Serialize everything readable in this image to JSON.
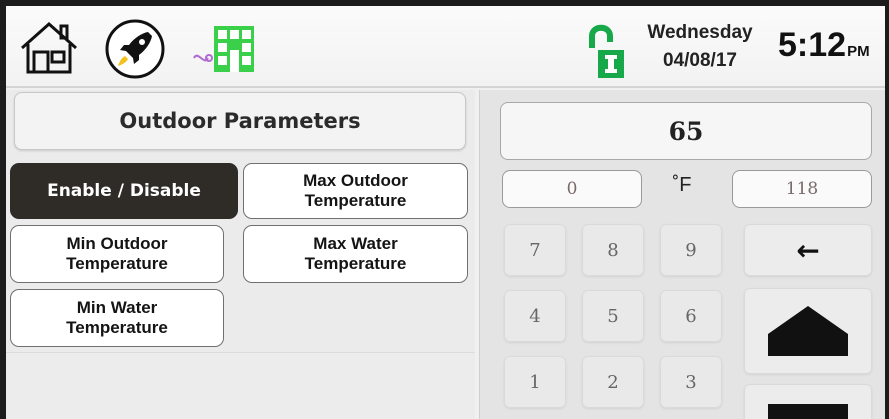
{
  "header": {
    "icons": [
      "home-icon",
      "rocket-icon",
      "building-icon",
      "lock-icon"
    ],
    "day": "Wednesday",
    "date": "04/08/17",
    "time": "5:12",
    "ampm": "PM"
  },
  "panel": {
    "title": "Outdoor Parameters",
    "buttons": {
      "enable": "Enable / Disable",
      "max_outdoor": "Max Outdoor\nTemperature",
      "min_outdoor": "Min Outdoor\nTemperature",
      "max_water": "Max Water\nTemperature",
      "min_water": "Min Water\nTemperature"
    },
    "selected": "Enable / Disable"
  },
  "keypad": {
    "value": "65",
    "min": "0",
    "unit": "˚F",
    "max": "118",
    "keys": [
      "7",
      "8",
      "9",
      "4",
      "5",
      "6",
      "1",
      "2",
      "3"
    ],
    "backspace_symbol": "←"
  },
  "colors": {
    "selected_button": "#2f2c28",
    "lock_green": "#17a84a",
    "building_green": "#3bd04a",
    "rocket_yellow": "#f2c21a"
  }
}
